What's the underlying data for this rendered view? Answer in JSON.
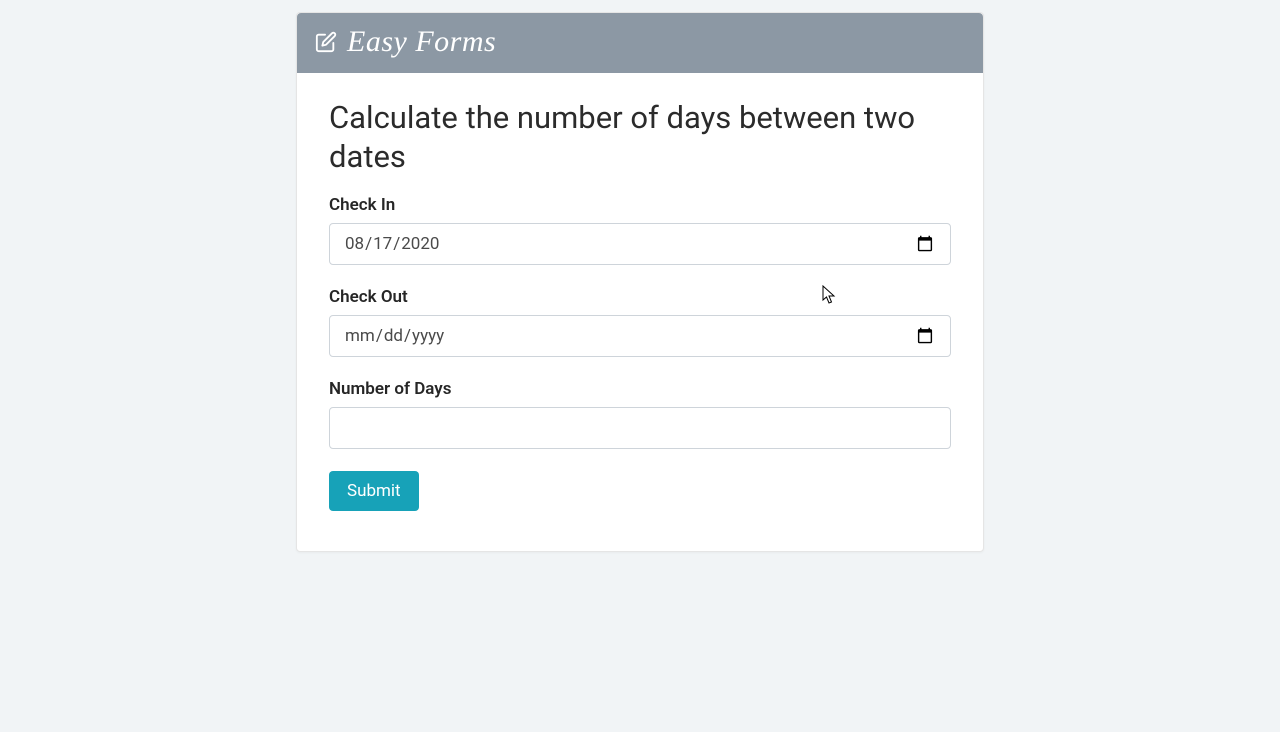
{
  "header": {
    "brand": "Easy Forms"
  },
  "form": {
    "title": "Calculate the number of days between two dates",
    "checkin": {
      "label": "Check In",
      "value": "2020-08-17"
    },
    "checkout": {
      "label": "Check Out",
      "value": "",
      "placeholder": "mm/dd/yyyy"
    },
    "days": {
      "label": "Number of Days",
      "value": ""
    },
    "submit_label": "Submit"
  }
}
